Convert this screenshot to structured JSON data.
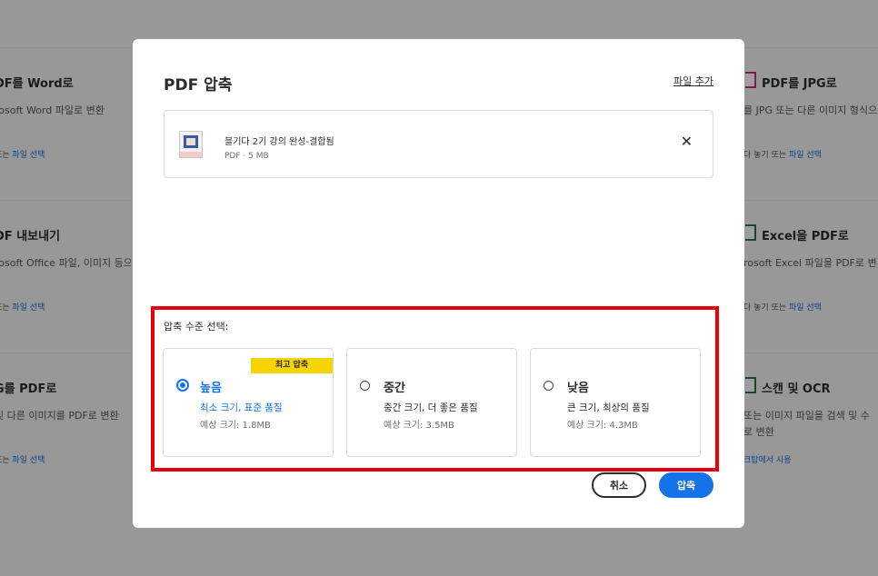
{
  "background_tools": {
    "left": [
      {
        "title": "DF를 Word로",
        "desc": "rosoft Word 파일로 변환",
        "link_prefix": "또는 ",
        "link": "파일 선택"
      },
      {
        "title": "DF 내보내기",
        "desc": "rosoft Office 파일, 이미지 등으",
        "link_prefix": "또는 ",
        "link": "파일 선택"
      },
      {
        "title": "G를 PDF로",
        "desc": "및 다른 이미지를 PDF로 변환",
        "link_prefix": "또는 ",
        "link": "파일 선택"
      }
    ],
    "right": [
      {
        "title": "PDF를 JPG로",
        "desc": "를 JPG 또는 다른 이미지 형식으",
        "link_prefix": "다 놓기 또는 ",
        "link": "파일 선택"
      },
      {
        "title": "Excel을 PDF로",
        "desc": "rosoft Excel 파일을 PDF로 변환",
        "link_prefix": "다 놓기 또는 ",
        "link": "파일 선택"
      },
      {
        "title": "스캔 및 OCR",
        "desc": "또는 이미지 파일을 검색 및 수",
        "desc2": "로 변환",
        "link_prefix": "",
        "link": "크탑에서 사용"
      }
    ]
  },
  "modal": {
    "title": "PDF 압축",
    "add_files": "파일 추가",
    "file": {
      "name": "블기다 2기 강의 완성-결합됨",
      "meta": "PDF · 5 MB",
      "remove_icon": "close-icon",
      "remove_glyph": "✕"
    },
    "level_label": "압축 수준 선택:",
    "options": [
      {
        "badge": "최고 압축",
        "title": "높음",
        "desc": "최소 크기, 표준 품질",
        "size": "예상 크기: 1.8MB",
        "selected": true
      },
      {
        "title": "중간",
        "desc": "중간 크기, 더 좋은 품질",
        "size": "예상 크기: 3.5MB",
        "selected": false
      },
      {
        "title": "낮음",
        "desc": "큰 크기, 최상의 품질",
        "size": "예상 크기: 4.3MB",
        "selected": false
      }
    ],
    "cancel_label": "취소",
    "compress_label": "압축"
  },
  "colors": {
    "accent": "#1473e6",
    "highlight_border": "#e8000b",
    "badge": "#f5d400"
  }
}
